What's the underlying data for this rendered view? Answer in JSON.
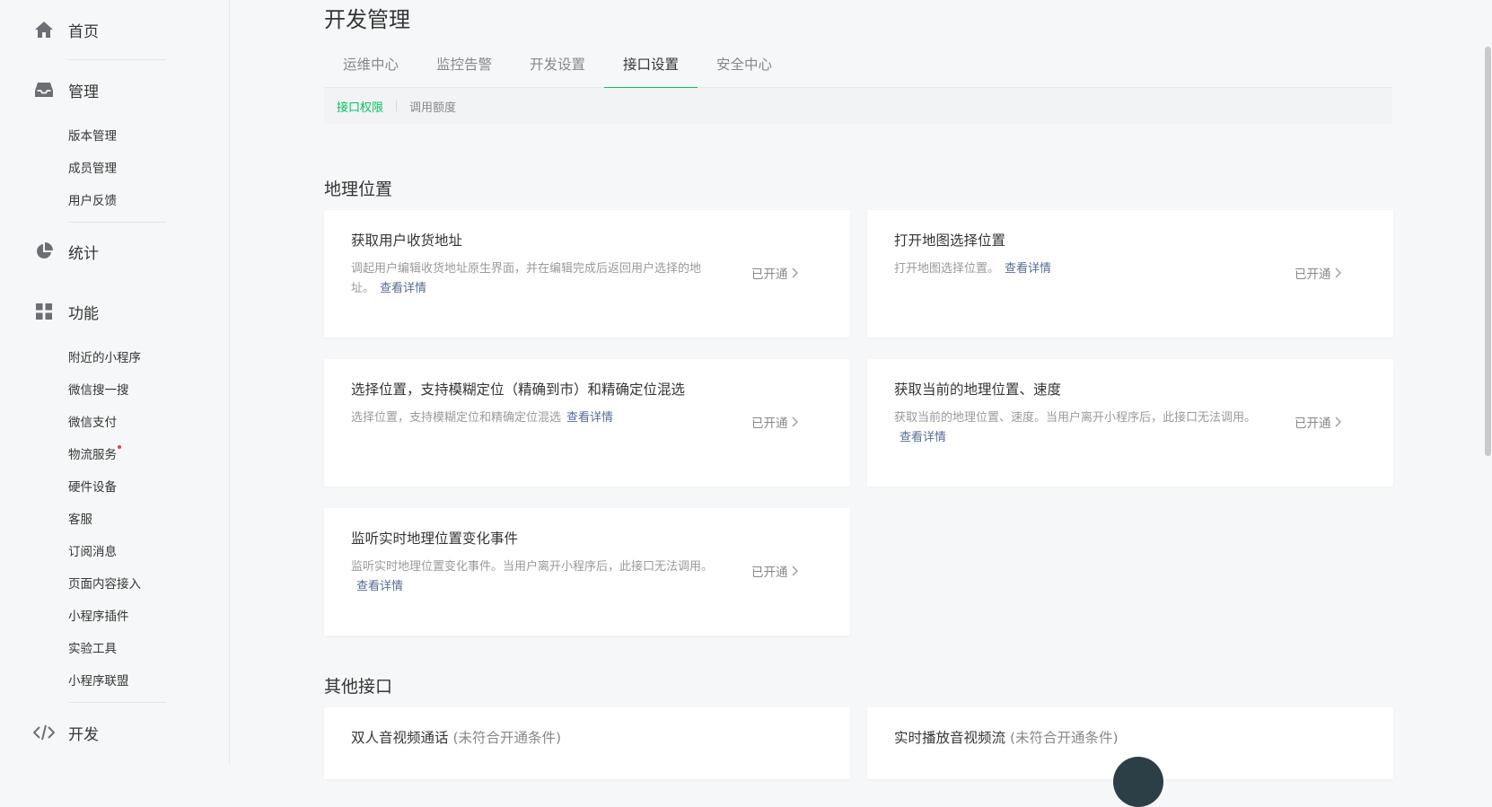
{
  "sidebar": {
    "home": "首页",
    "manage": "管理",
    "manage_items": [
      "版本管理",
      "成员管理",
      "用户反馈"
    ],
    "stats": "统计",
    "features": "功能",
    "feature_items": [
      "附近的小程序",
      "微信搜一搜",
      "微信支付",
      "物流服务",
      "硬件设备",
      "客服",
      "订阅消息",
      "页面内容接入",
      "小程序插件",
      "实验工具",
      "小程序联盟"
    ],
    "dev": "开发"
  },
  "page": {
    "title": "开发管理",
    "tabs": [
      "运维中心",
      "监控告警",
      "开发设置",
      "接口设置",
      "安全中心"
    ],
    "active_tab": "接口设置",
    "subtabs": [
      "接口权限",
      "调用额度"
    ]
  },
  "sections": {
    "geo": {
      "title": "地理位置",
      "cards": [
        {
          "title": "获取用户收货地址",
          "desc": "调起用户编辑收货地址原生界面，并在编辑完成后返回用户选择的地址。",
          "link": "查看详情",
          "status": "已开通"
        },
        {
          "title": "打开地图选择位置",
          "desc": "打开地图选择位置。",
          "link": "查看详情",
          "status": "已开通"
        },
        {
          "title": "选择位置，支持模糊定位（精确到市）和精确定位混选",
          "desc": "选择位置，支持模糊定位和精确定位混选",
          "link": "查看详情",
          "status": "已开通"
        },
        {
          "title": "获取当前的地理位置、速度",
          "desc": "获取当前的地理位置、速度。当用户离开小程序后，此接口无法调用。",
          "link": "查看详情",
          "status": "已开通"
        },
        {
          "title": "监听实时地理位置变化事件",
          "desc": "监听实时地理位置变化事件。当用户离开小程序后，此接口无法调用。",
          "link": "查看详情",
          "status": "已开通"
        }
      ]
    },
    "other": {
      "title": "其他接口",
      "cards": [
        {
          "title": "双人音视频通话",
          "condition": "(未符合开通条件)"
        },
        {
          "title": "实时播放音视频流",
          "condition": "(未符合开通条件)"
        }
      ]
    }
  },
  "colors": {
    "accent": "#07c160",
    "link": "#576b95",
    "muted": "#9a9a9a"
  }
}
